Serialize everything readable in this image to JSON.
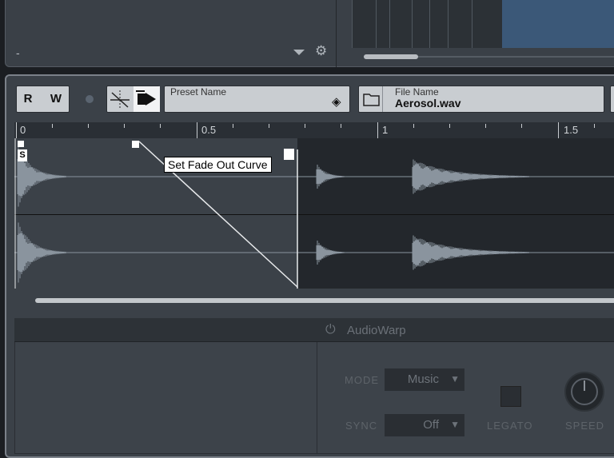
{
  "top": {
    "dash_label": "-",
    "dropdown_icon": "chevron-down-icon",
    "gear_icon": "gear-icon"
  },
  "toolbar": {
    "read_label": "R",
    "write_label": "W",
    "preset_label": "Preset Name",
    "preset_value": "",
    "file_label": "File Name",
    "file_value": "Aerosol.wav"
  },
  "ruler": {
    "labels": [
      "0",
      "0.5",
      "1",
      "1.5"
    ]
  },
  "waveform": {
    "start_handle_label": "S",
    "tooltip": "Set Fade Out Curve"
  },
  "audiowarp": {
    "title": "AudioWarp",
    "mode_label": "MODE",
    "mode_value": "Music",
    "sync_label": "SYNC",
    "sync_value": "Off",
    "legato_label": "LEGATO",
    "speed_label": "SPEED"
  },
  "colors": {
    "panel": "#3b4148",
    "waveform": "#8a949e",
    "highlight": "#3b5878"
  }
}
